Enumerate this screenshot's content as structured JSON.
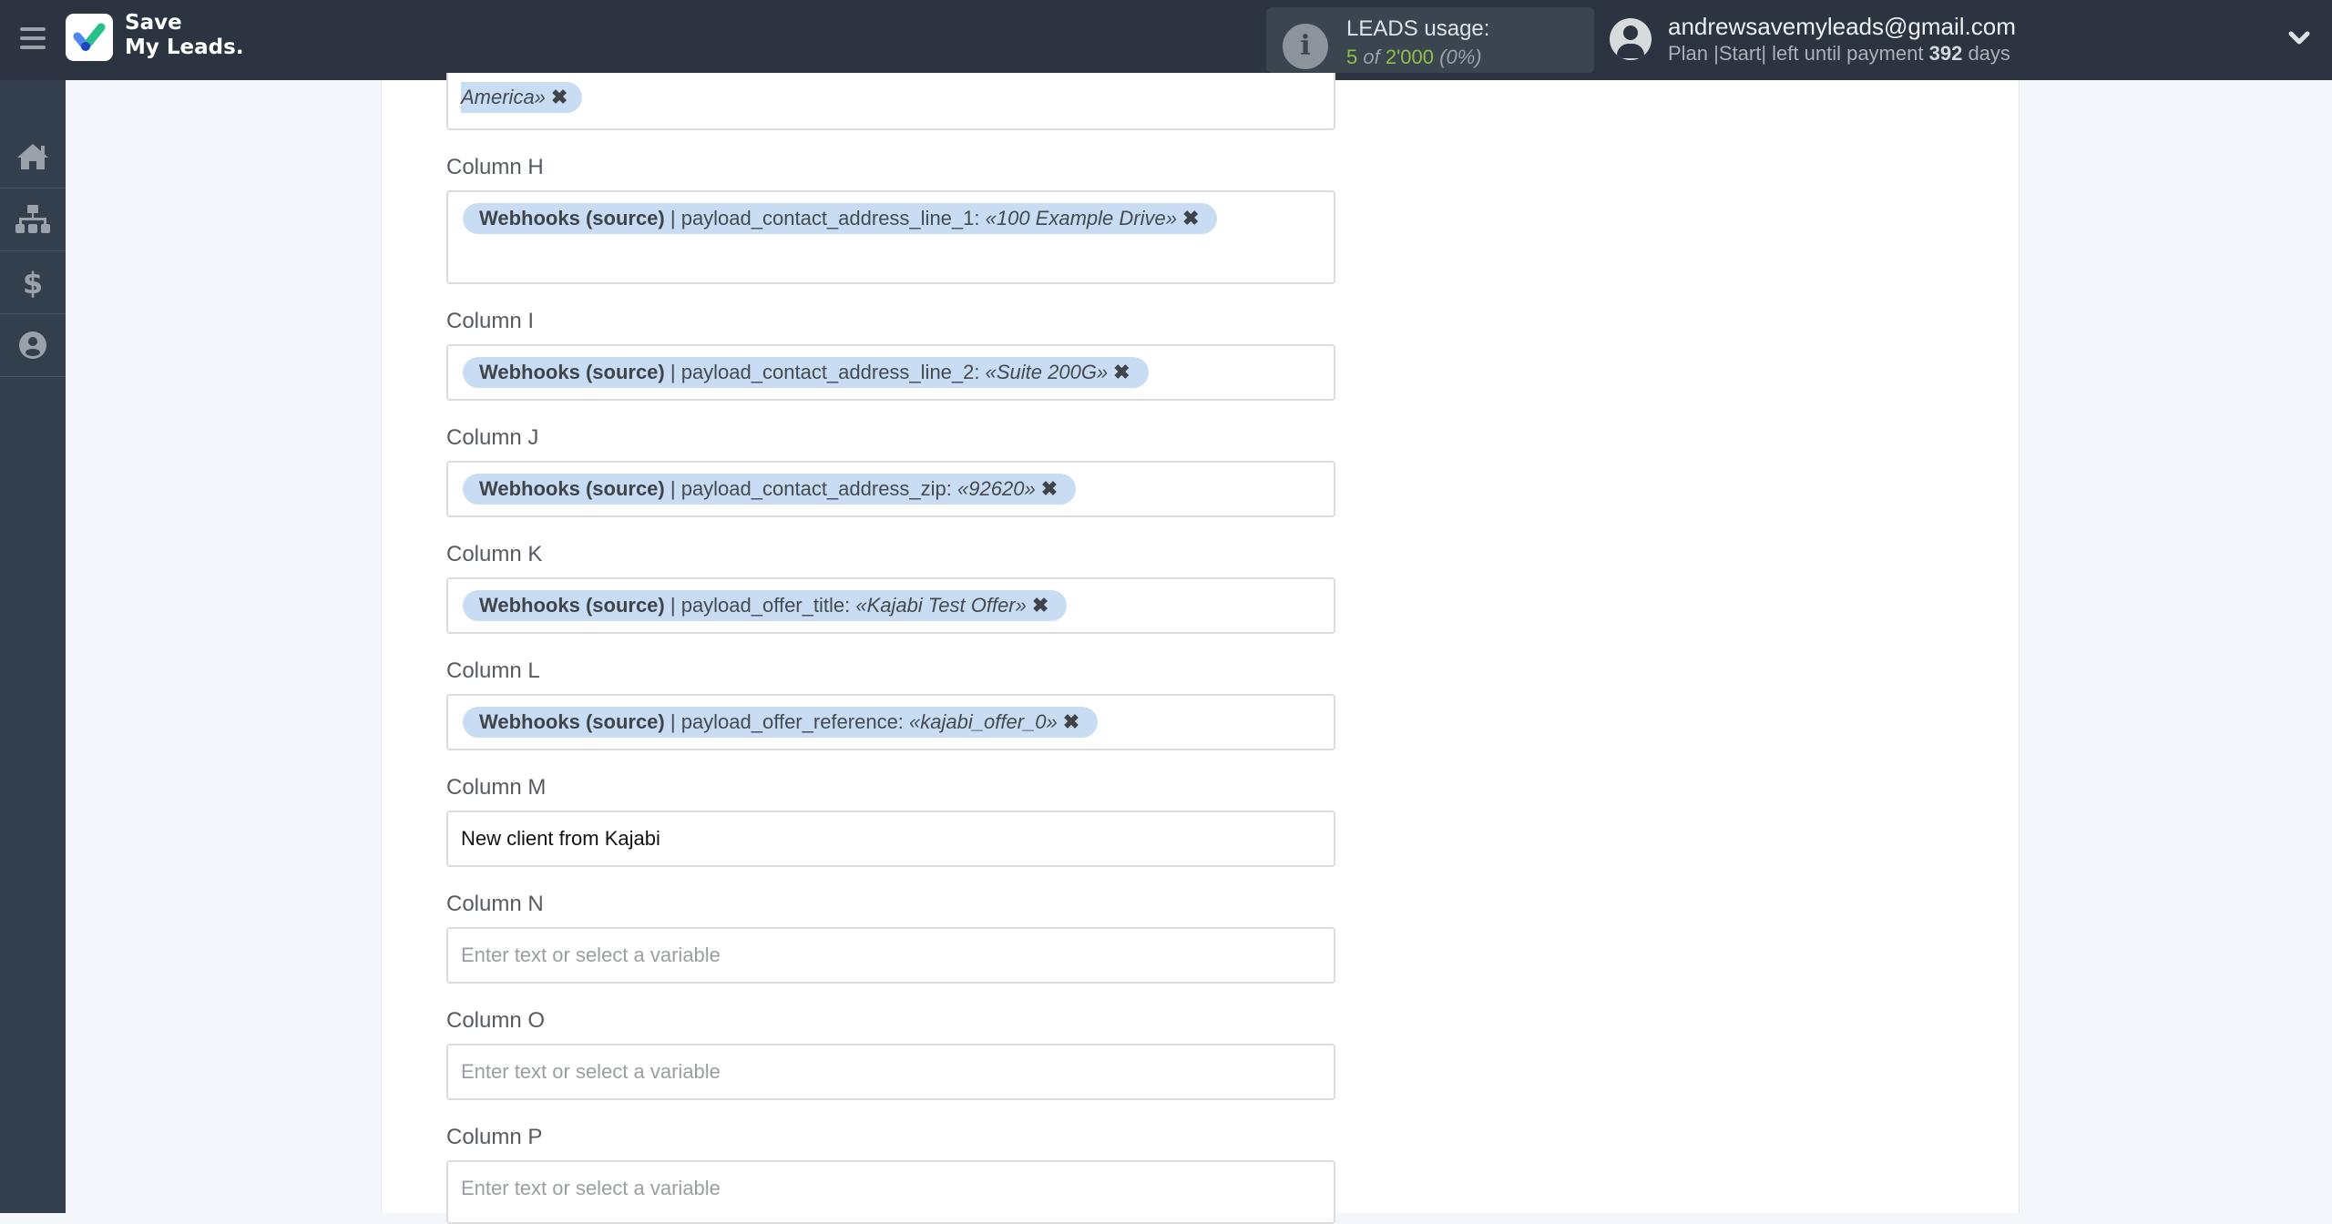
{
  "header": {
    "logo_line1": "Save",
    "logo_line2": "My Leads.",
    "usage_title": "LEADS usage:",
    "usage_used": "5",
    "usage_of": "of",
    "usage_total": "2'000",
    "usage_percent": "(0%)",
    "email": "andrewsavemyleads@gmail.com",
    "plan_prefix": "Plan |Start| left until payment",
    "plan_days": "392",
    "plan_suffix": "days"
  },
  "sidebar": {
    "items": [
      {
        "icon": "home-icon"
      },
      {
        "icon": "sitemap-icon"
      },
      {
        "icon": "dollar-icon"
      },
      {
        "icon": "user-circle-icon"
      }
    ]
  },
  "fields": {
    "prev_tag_value": "America»",
    "colH": {
      "label": "Column H",
      "source": "Webhooks (source)",
      "field": "| payload_contact_address_line_1:",
      "value": "«100 Example Drive»"
    },
    "colI": {
      "label": "Column I",
      "source": "Webhooks (source)",
      "field": "| payload_contact_address_line_2:",
      "value": "«Suite 200G»"
    },
    "colJ": {
      "label": "Column J",
      "source": "Webhooks (source)",
      "field": "| payload_contact_address_zip:",
      "value": "«92620»"
    },
    "colK": {
      "label": "Column K",
      "source": "Webhooks (source)",
      "field": "| payload_offer_title:",
      "value": "«Kajabi Test Offer»"
    },
    "colL": {
      "label": "Column L",
      "source": "Webhooks (source)",
      "field": "| payload_offer_reference:",
      "value": "«kajabi_offer_0»"
    },
    "colM": {
      "label": "Column M",
      "value": "New client from Kajabi"
    },
    "colN": {
      "label": "Column N",
      "placeholder": "Enter text or select a variable"
    },
    "colO": {
      "label": "Column O",
      "placeholder": "Enter text or select a variable"
    },
    "colP": {
      "label": "Column P",
      "placeholder": "Enter text or select a variable"
    },
    "remove_glyph": "✖"
  }
}
